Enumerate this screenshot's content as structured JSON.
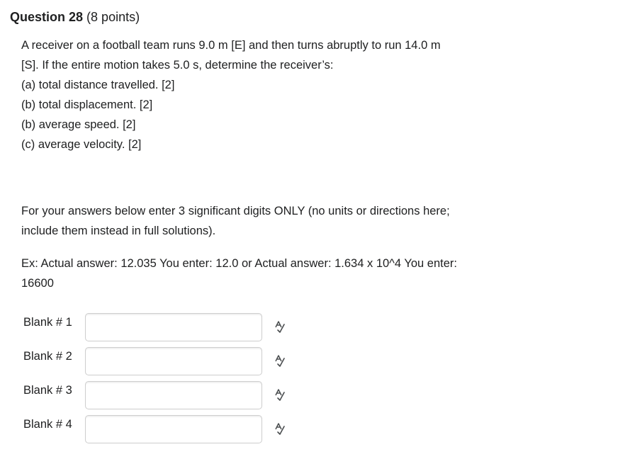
{
  "question": {
    "title": "Question 28",
    "points": "(8 points)"
  },
  "prompt_lines": [
    "A receiver on a football team runs 9.0 m [E] and then turns abruptly to run 14.0 m",
    "[S]. If the entire motion takes 5.0 s, determine the receiver’s:",
    "(a) total distance travelled. [2]",
    "(b) total displacement. [2]",
    "(b) average speed. [2]",
    "(c) average velocity. [2]"
  ],
  "instructions_lines": [
    "For your answers below enter 3 significant digits ONLY (no units or directions here;",
    "include them instead in full solutions)."
  ],
  "example_lines": [
    "Ex: Actual answer: 12.035 You enter: 12.0 or Actual answer: 1.634 x 10^4 You enter:",
    "16600"
  ],
  "blanks": [
    {
      "label": "Blank # 1",
      "value": "",
      "icon": "spellcheck-icon"
    },
    {
      "label": "Blank # 2",
      "value": "",
      "icon": "spellcheck-icon"
    },
    {
      "label": "Blank # 3",
      "value": "",
      "icon": "spellcheck-icon"
    },
    {
      "label": "Blank # 4",
      "value": "",
      "icon": "spellcheck-icon"
    }
  ],
  "colors": {
    "text": "#202122",
    "input_border": "#cdcdcd",
    "icon": "#494c4e"
  }
}
